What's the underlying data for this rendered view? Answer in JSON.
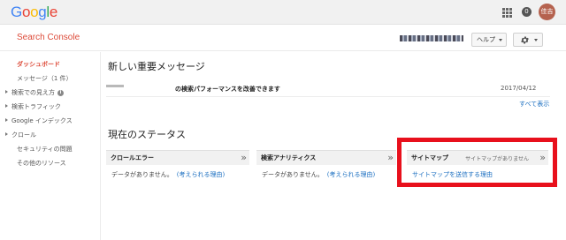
{
  "topbar": {
    "logo": [
      "G",
      "o",
      "o",
      "g",
      "l",
      "e"
    ],
    "logo_colors": [
      "#4285f4",
      "#ea4335",
      "#fbbc05",
      "#4285f4",
      "#34a853",
      "#ea4335"
    ],
    "apps_icon": "apps-grid-icon",
    "notifications_icon": "notifications-icon",
    "notifications_badge": "0",
    "avatar_text": "佳吉"
  },
  "header": {
    "product_name": "Search Console",
    "help_label": "ヘルプ",
    "settings_icon": "gear-icon"
  },
  "sidebar": {
    "items": [
      {
        "label": "ダッシュボード",
        "active": true,
        "tree": false
      },
      {
        "label": "メッセージ（1 件）",
        "active": false,
        "tree": false
      },
      {
        "label": "検索での見え方",
        "active": false,
        "tree": true,
        "info": true
      },
      {
        "label": "検索トラフィック",
        "active": false,
        "tree": true
      },
      {
        "label": "Google インデックス",
        "active": false,
        "tree": true
      },
      {
        "label": "クロール",
        "active": false,
        "tree": true
      },
      {
        "label": "セキュリティの問題",
        "active": false,
        "tree": false
      },
      {
        "label": "その他のリソース",
        "active": false,
        "tree": false
      }
    ]
  },
  "main": {
    "new_messages_heading": "新しい重要メッセージ",
    "message": {
      "title": "の検索パフォーマンスを改善できます",
      "date": "2017/04/12"
    },
    "show_all": "すべて表示",
    "status_heading": "現在のステータス",
    "cards": [
      {
        "title": "クロールエラー",
        "body": "データがありません。",
        "link": "(考えられる理由)"
      },
      {
        "title": "検索アナリティクス",
        "body": "データがありません。",
        "link": "(考えられる理由)"
      },
      {
        "title": "サイトマップ",
        "subtitle": "サイトマップがありません",
        "link": "サイトマップを送信する理由"
      }
    ],
    "highlight_color": "#e8101c"
  }
}
